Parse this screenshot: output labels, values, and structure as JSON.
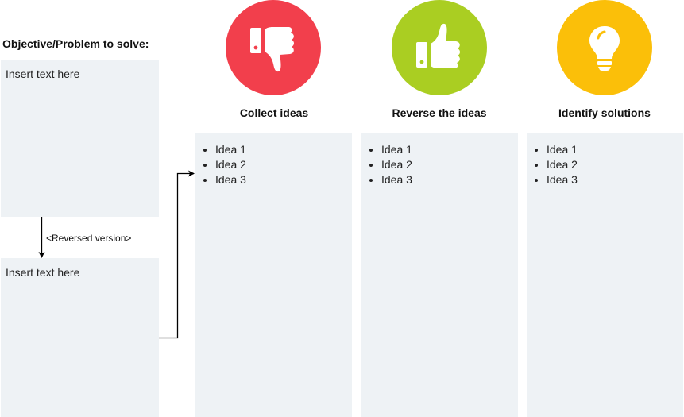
{
  "objective": {
    "title": "Objective/Problem to solve:",
    "box_text": "Insert text here"
  },
  "reversed": {
    "label": "<Reversed version>",
    "box_text": "Insert text here"
  },
  "columns": [
    {
      "title": "Collect ideas",
      "icon": "thumbs-down-icon",
      "color": "#F23F4C",
      "items": [
        "Idea 1",
        "Idea 2",
        "Idea 3"
      ]
    },
    {
      "title": "Reverse the ideas",
      "icon": "thumbs-up-icon",
      "color": "#AACE22",
      "items": [
        "Idea 1",
        "Idea 2",
        "Idea 3"
      ]
    },
    {
      "title": "Identify solutions",
      "icon": "lightbulb-icon",
      "color": "#FBBF09",
      "items": [
        "Idea 1",
        "Idea 2",
        "Idea 3"
      ]
    }
  ],
  "colors": {
    "panel_background": "#EEF2F5",
    "connector": "#000000"
  }
}
